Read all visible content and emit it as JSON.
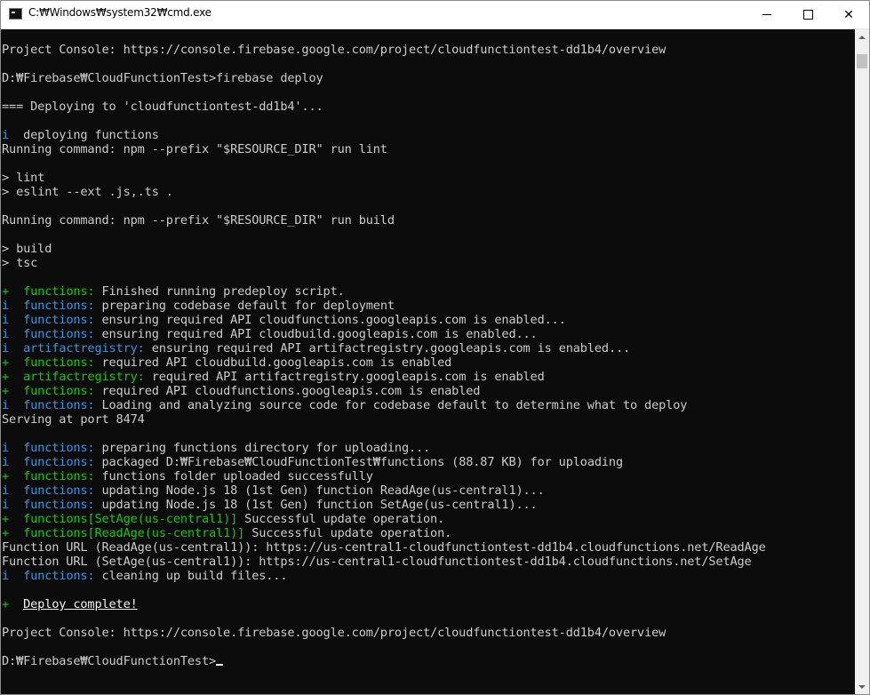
{
  "window": {
    "title": "C:₩Windows₩system32₩cmd.exe"
  },
  "lines": [
    [
      {
        "t": "Project Console: https://console.firebase.google.com/project/cloudfunctiontest-dd1b4/overview",
        "c": ""
      }
    ],
    [
      {
        "t": "",
        "c": ""
      }
    ],
    [
      {
        "t": "D:₩Firebase₩CloudFunctionTest>firebase deploy",
        "c": ""
      }
    ],
    [
      {
        "t": "",
        "c": ""
      }
    ],
    [
      {
        "t": "=== Deploying to 'cloudfunctiontest-dd1b4'...",
        "c": ""
      }
    ],
    [
      {
        "t": "",
        "c": ""
      }
    ],
    [
      {
        "t": "i  ",
        "c": "c"
      },
      {
        "t": "deploying ",
        "c": ""
      },
      {
        "t": "functions",
        "c": ""
      }
    ],
    [
      {
        "t": "Running command: npm --prefix \"$RESOURCE_DIR\" run lint",
        "c": ""
      }
    ],
    [
      {
        "t": "",
        "c": ""
      }
    ],
    [
      {
        "t": "> lint",
        "c": ""
      }
    ],
    [
      {
        "t": "> eslint --ext .js,.ts .",
        "c": ""
      }
    ],
    [
      {
        "t": "",
        "c": ""
      }
    ],
    [
      {
        "t": "Running command: npm --prefix \"$RESOURCE_DIR\" run build",
        "c": ""
      }
    ],
    [
      {
        "t": "",
        "c": ""
      }
    ],
    [
      {
        "t": "> build",
        "c": ""
      }
    ],
    [
      {
        "t": "> tsc",
        "c": ""
      }
    ],
    [
      {
        "t": "",
        "c": ""
      }
    ],
    [
      {
        "t": "+  ",
        "c": "g"
      },
      {
        "t": "functions:",
        "c": "g"
      },
      {
        "t": " Finished running ",
        "c": ""
      },
      {
        "t": "predeploy",
        "c": ""
      },
      {
        "t": " script.",
        "c": ""
      }
    ],
    [
      {
        "t": "i  ",
        "c": "c"
      },
      {
        "t": "functions:",
        "c": "c"
      },
      {
        "t": " preparing codebase ",
        "c": ""
      },
      {
        "t": "default",
        "c": ""
      },
      {
        "t": " for deployment",
        "c": ""
      }
    ],
    [
      {
        "t": "i  ",
        "c": "c"
      },
      {
        "t": "functions:",
        "c": "c"
      },
      {
        "t": " ensuring required API ",
        "c": ""
      },
      {
        "t": "cloudfunctions.googleapis.com",
        "c": ""
      },
      {
        "t": " is enabled...",
        "c": ""
      }
    ],
    [
      {
        "t": "i  ",
        "c": "c"
      },
      {
        "t": "functions:",
        "c": "c"
      },
      {
        "t": " ensuring required API ",
        "c": ""
      },
      {
        "t": "cloudbuild.googleapis.com",
        "c": ""
      },
      {
        "t": " is enabled...",
        "c": ""
      }
    ],
    [
      {
        "t": "i  ",
        "c": "c"
      },
      {
        "t": "artifactregistry:",
        "c": "c"
      },
      {
        "t": " ensuring required API ",
        "c": ""
      },
      {
        "t": "artifactregistry.googleapis.com",
        "c": ""
      },
      {
        "t": " is enabled...",
        "c": ""
      }
    ],
    [
      {
        "t": "+  ",
        "c": "g"
      },
      {
        "t": "functions:",
        "c": "g"
      },
      {
        "t": " required API ",
        "c": ""
      },
      {
        "t": "cloudbuild.googleapis.com",
        "c": ""
      },
      {
        "t": " is enabled",
        "c": ""
      }
    ],
    [
      {
        "t": "+  ",
        "c": "g"
      },
      {
        "t": "artifactregistry:",
        "c": "g"
      },
      {
        "t": " required API ",
        "c": ""
      },
      {
        "t": "artifactregistry.googleapis.com",
        "c": ""
      },
      {
        "t": " is enabled",
        "c": ""
      }
    ],
    [
      {
        "t": "+  ",
        "c": "g"
      },
      {
        "t": "functions:",
        "c": "g"
      },
      {
        "t": " required API ",
        "c": ""
      },
      {
        "t": "cloudfunctions.googleapis.com",
        "c": ""
      },
      {
        "t": " is enabled",
        "c": ""
      }
    ],
    [
      {
        "t": "i  ",
        "c": "c"
      },
      {
        "t": "functions:",
        "c": "c"
      },
      {
        "t": " Loading and analyzing source code for codebase default to determine what to deploy",
        "c": ""
      }
    ],
    [
      {
        "t": "Serving at port 8474",
        "c": ""
      }
    ],
    [
      {
        "t": "",
        "c": ""
      }
    ],
    [
      {
        "t": "i  ",
        "c": "c"
      },
      {
        "t": "functions:",
        "c": "c"
      },
      {
        "t": " preparing ",
        "c": ""
      },
      {
        "t": "functions",
        "c": ""
      },
      {
        "t": " directory for uploading...",
        "c": ""
      }
    ],
    [
      {
        "t": "i  ",
        "c": "c"
      },
      {
        "t": "functions:",
        "c": "c"
      },
      {
        "t": " packaged ",
        "c": ""
      },
      {
        "t": "D:₩Firebase₩CloudFunctionTest₩functions",
        "c": ""
      },
      {
        "t": " (88.87 KB) for uploading",
        "c": ""
      }
    ],
    [
      {
        "t": "+  ",
        "c": "g"
      },
      {
        "t": "functions:",
        "c": "g"
      },
      {
        "t": " ",
        "c": ""
      },
      {
        "t": "functions",
        "c": ""
      },
      {
        "t": " folder uploaded successfully",
        "c": ""
      }
    ],
    [
      {
        "t": "i  ",
        "c": "c"
      },
      {
        "t": "functions:",
        "c": "c"
      },
      {
        "t": " updating Node.js 18 (1st Gen) function ",
        "c": ""
      },
      {
        "t": "ReadAge(us-central1)",
        "c": ""
      },
      {
        "t": "...",
        "c": ""
      }
    ],
    [
      {
        "t": "i  ",
        "c": "c"
      },
      {
        "t": "functions:",
        "c": "c"
      },
      {
        "t": " updating Node.js 18 (1st Gen) function ",
        "c": ""
      },
      {
        "t": "SetAge(us-central1)",
        "c": ""
      },
      {
        "t": "...",
        "c": ""
      }
    ],
    [
      {
        "t": "+  ",
        "c": "g"
      },
      {
        "t": "functions[SetAge(us-central1)]",
        "c": "g"
      },
      {
        "t": " Successful update operation.",
        "c": ""
      }
    ],
    [
      {
        "t": "+  ",
        "c": "g"
      },
      {
        "t": "functions[ReadAge(us-central1)]",
        "c": "g"
      },
      {
        "t": " Successful update operation.",
        "c": ""
      }
    ],
    [
      {
        "t": "Function URL (ReadAge(us-central1)): https://us-central1-cloudfunctiontest-dd1b4.cloudfunctions.net/ReadAge",
        "c": ""
      }
    ],
    [
      {
        "t": "Function URL (SetAge(us-central1)): https://us-central1-cloudfunctiontest-dd1b4.cloudfunctions.net/SetAge",
        "c": ""
      }
    ],
    [
      {
        "t": "i  ",
        "c": "c"
      },
      {
        "t": "functions:",
        "c": "c"
      },
      {
        "t": " cleaning up build files...",
        "c": ""
      }
    ],
    [
      {
        "t": "",
        "c": ""
      }
    ],
    [
      {
        "t": "+  ",
        "c": "g"
      },
      {
        "t": "Deploy complete!",
        "c": "u"
      }
    ],
    [
      {
        "t": "",
        "c": ""
      }
    ],
    [
      {
        "t": "Project Console: https://console.firebase.google.com/project/cloudfunctiontest-dd1b4/overview",
        "c": ""
      }
    ],
    [
      {
        "t": "",
        "c": ""
      }
    ],
    [
      {
        "t": "D:₩Firebase₩CloudFunctionTest>",
        "c": ""
      },
      {
        "t": "",
        "c": "cursor"
      }
    ]
  ],
  "colors": {
    "background": "#0c0c0c",
    "text": "#cccccc",
    "green": "#16c60c",
    "cyan": "#3a96dd",
    "bright": "#f2f2f2"
  }
}
